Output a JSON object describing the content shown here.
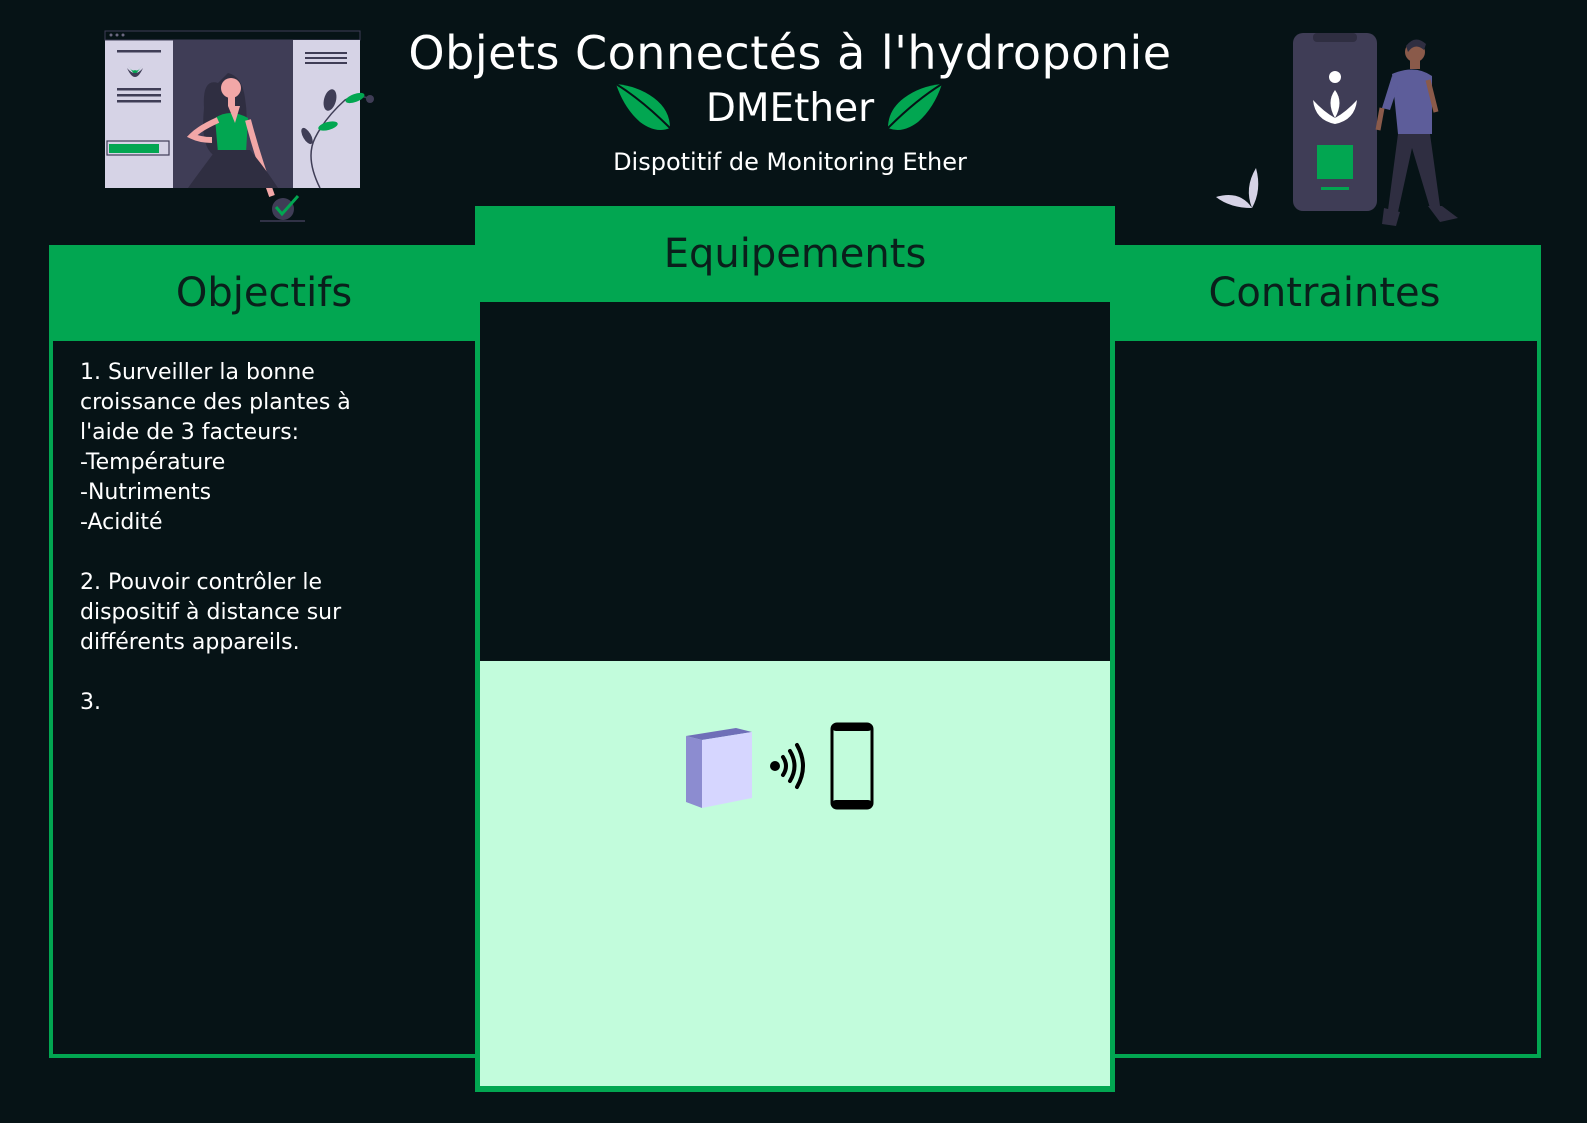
{
  "header": {
    "title": "Objets Connectés à l'hydroponie",
    "subtitle": "DMEther",
    "tagline": "Dispotitif de Monitoring Ether"
  },
  "columns": {
    "objectifs": {
      "title": "Objectifs",
      "text": "1. Surveiller la bonne\ncroissance des plantes à\nl'aide de 3 facteurs:\n-Température\n-Nutriments\n-Acidité\n\n2. Pouvoir contrôler le\ndispositif à distance sur\ndifférents appareils.\n\n3."
    },
    "equipements": {
      "title": "Equipements",
      "diagram_icons": [
        "device-box-icon",
        "wireless-signal-icon",
        "smartphone-icon"
      ]
    },
    "contraintes": {
      "title": "Contraintes"
    }
  },
  "illustrations": [
    "woman-dashboard-illustration",
    "leaf-left-icon",
    "leaf-right-icon",
    "man-phone-illustration"
  ],
  "colors": {
    "background": "#061316",
    "accent_green": "#02a651",
    "light_green_panel": "#c2fcdc",
    "header_text": "#0a1f1b",
    "text": "#ffffff"
  }
}
